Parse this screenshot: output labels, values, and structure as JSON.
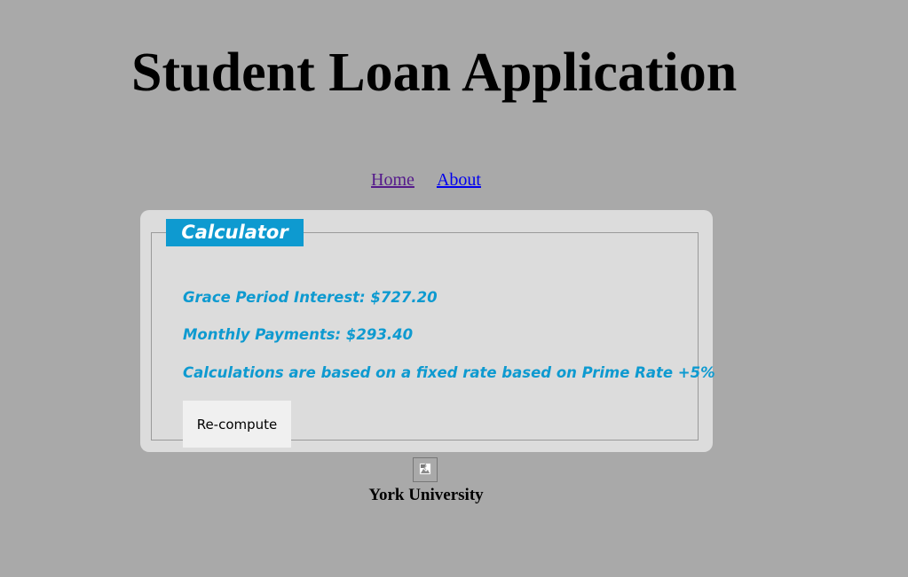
{
  "header": {
    "title": "Student Loan Application"
  },
  "nav": {
    "items": [
      {
        "label": "Home"
      },
      {
        "label": "About"
      }
    ]
  },
  "calculator": {
    "legend": "Calculator",
    "grace_period_interest": "Grace Period Interest: $727.20",
    "monthly_payments": "Monthly Payments: $293.40",
    "note": "Calculations are based on a fixed rate based on Prime Rate +5%",
    "recompute_label": "Re-compute"
  },
  "footer": {
    "logo_icon": "broken-image-icon",
    "institution": "York University"
  }
}
